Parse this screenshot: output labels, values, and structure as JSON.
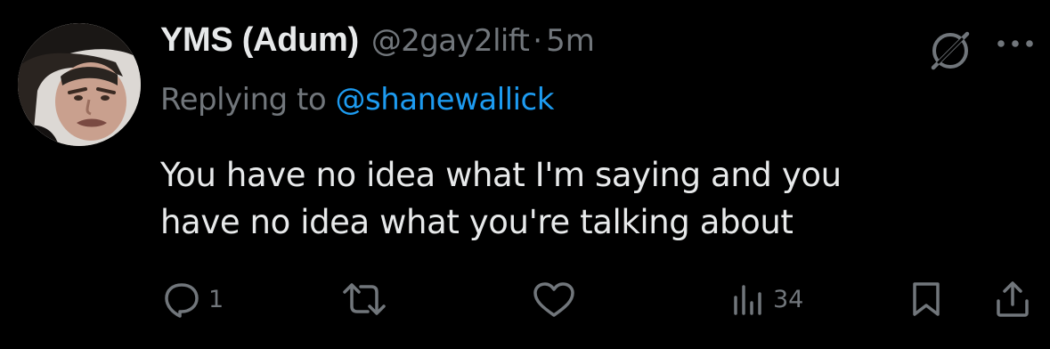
{
  "tweet": {
    "author": {
      "display_name": "YMS (Adum)",
      "handle": "@2gay2lift",
      "separator": "·",
      "time": "5m"
    },
    "reply": {
      "prefix": "Replying to ",
      "to_handle": "@shanewallick"
    },
    "body_lines": [
      "You have no idea what I'm saying and you",
      "have no idea what you're talking about"
    ],
    "actions": {
      "reply_count": "1",
      "retweet_count": "",
      "like_count": "",
      "views_count": "34"
    },
    "icons": {
      "grok": "grok-icon",
      "more": "more-icon",
      "reply": "reply-icon",
      "retweet": "retweet-icon",
      "like": "heart-icon",
      "views": "views-icon",
      "bookmark": "bookmark-icon",
      "share": "share-icon"
    }
  },
  "colors": {
    "background": "#000000",
    "primary_text": "#e7e9ea",
    "secondary_text": "#71767b",
    "link": "#1d9bf0"
  }
}
